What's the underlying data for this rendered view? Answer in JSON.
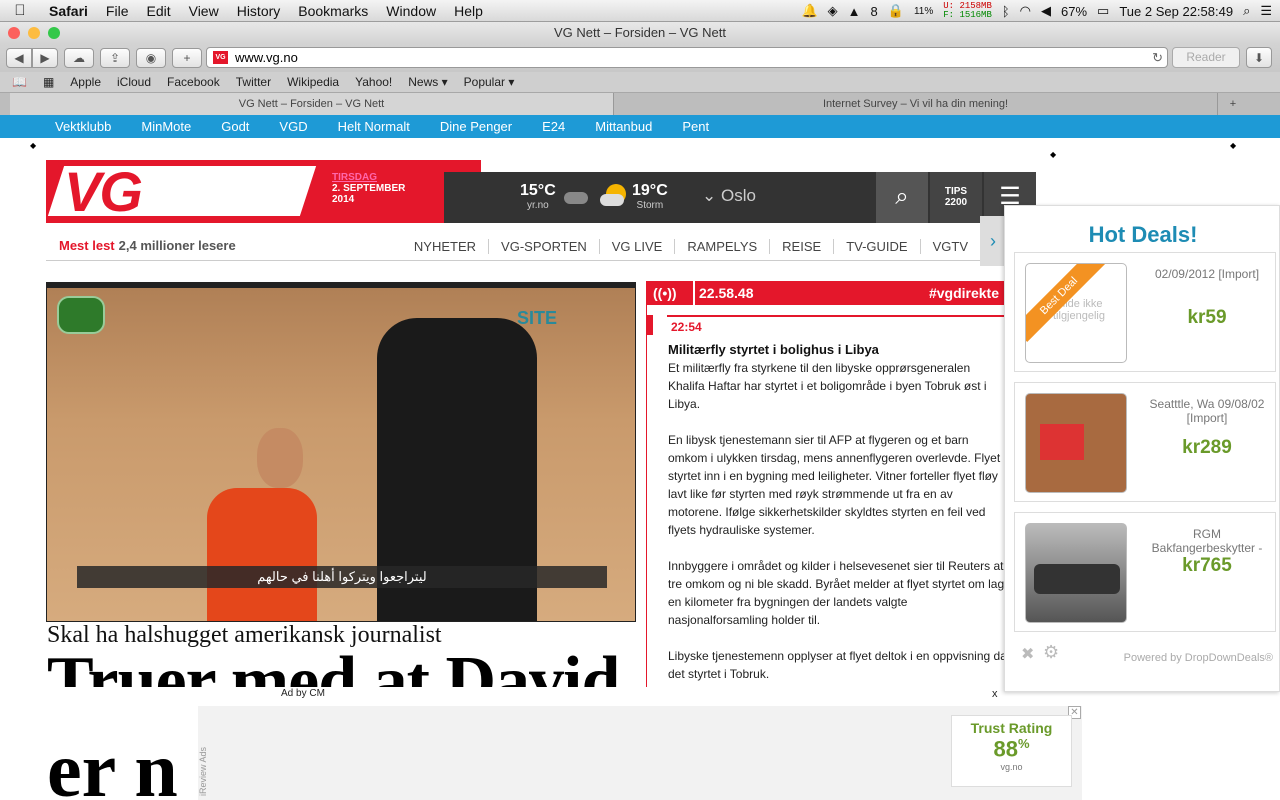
{
  "menubar": {
    "app": "Safari",
    "items": [
      "File",
      "Edit",
      "View",
      "History",
      "Bookmarks",
      "Window",
      "Help"
    ],
    "status": {
      "mem_used": "U: 2158MB",
      "mem_free": "F: 1516MB",
      "cpu": "11%",
      "battery": "67%",
      "clock": "Tue 2 Sep  22:58:49",
      "badge": "8"
    }
  },
  "window": {
    "title": "VG Nett – Forsiden – VG Nett"
  },
  "toolbar": {
    "url": "www.vg.no",
    "reader": "Reader",
    "favicon": "VG"
  },
  "bookmarks": [
    "Apple",
    "iCloud",
    "Facebook",
    "Twitter",
    "Wikipedia",
    "Yahoo!",
    "News ▾",
    "Popular ▾"
  ],
  "tabs": [
    {
      "label": "VG Nett – Forsiden – VG Nett",
      "active": true
    },
    {
      "label": "Internet Survey – Vi vil ha din mening!",
      "active": false
    }
  ],
  "bluenav": [
    "Vektklubb",
    "MinMote",
    "Godt",
    "VGD",
    "Helt Normalt",
    "Dine Penger",
    "E24",
    "Mittanbud",
    "Pent"
  ],
  "vg": {
    "logo": "VG",
    "date_day": "TIRSDAG",
    "date_line": "2. SEPTEMBER",
    "date_year": "2014",
    "weather1": {
      "temp": "15°C",
      "source": "yr.no"
    },
    "weather2": {
      "temp": "19°C",
      "source": "Storm"
    },
    "city": "Oslo",
    "tips": "TIPS",
    "tips_number": "2200"
  },
  "secnav": {
    "mest_lest": "Mest lest",
    "lesere": "2,4 millioner lesere",
    "items": [
      "NYHETER",
      "VG-SPORTEN",
      "VG LIVE",
      "RAMPELYS",
      "REISE",
      "TV-GUIDE",
      "VGTV"
    ]
  },
  "main_story": {
    "image_caption": "ليتراجعوا ويتركوا أهلنا في حالهم",
    "image_logo": "SITE",
    "subhead": "Skal ha halshugget amerikansk journalist",
    "headline": "Truer med at David",
    "headline2": "er n"
  },
  "direkte": {
    "clock": "22.58.48",
    "tag": "#vgdirekte",
    "entry_time": "22:54",
    "title": "Militærfly styrtet i bolighus i Libya",
    "paragraphs": [
      "Et militærfly fra styrkene til den libyske opprørsgeneralen Khalifa Haftar har styrtet i et boligområde i byen Tobruk øst i Libya.",
      "En libysk tjenestemann sier til AFP at flygeren og et barn omkom i ulykken tirsdag, mens annenflygeren overlevde. Flyet styrtet inn i en bygning med leiligheter. Vitner forteller flyet fløy lavt like før styrten med røyk strømmende ut fra en av motorene. Ifølge sikkerhetskilder skyldtes styrten en feil ved flyets hydrauliske systemer.",
      "Innbyggere i området og kilder i helsevesenet sier til Reuters at tre omkom og ni ble skadd. Byrået melder at flyet styrtet om lag en kilometer fra bygningen der landets valgte nasjonalforsamling holder til.",
      "Libyske tjenestemenn opplyser at flyet deltok i en oppvisning da det styrtet i Tobruk."
    ]
  },
  "hotdeals": {
    "title": "Hot Deals!",
    "ribbon": "Best Deal",
    "deals": [
      {
        "info": "02/09/2012 [Import]",
        "price": "kr59",
        "thumb_text": "Bilde ikke tilgjengelig"
      },
      {
        "info": "Seatttle, Wa 09/08/02 [Import]",
        "price": "kr289",
        "thumb_text": ""
      },
      {
        "info": "RGM Bakfangerbeskytter - ABS",
        "price": "kr765",
        "thumb_text": ""
      }
    ],
    "powered": "Powered by DropDownDeals®"
  },
  "ad": {
    "label": "Ad by CM",
    "close": "x",
    "side_text": "iReview Ads",
    "trust_title": "Trust Rating",
    "trust_value": "88",
    "trust_unit": "%",
    "trust_site": "vg.no"
  },
  "colors": {
    "vg_red": "#e4172b",
    "nav_blue": "#1e9ad6",
    "deal_green": "#6a9a2a",
    "hot_blue": "#1e8cb4"
  }
}
